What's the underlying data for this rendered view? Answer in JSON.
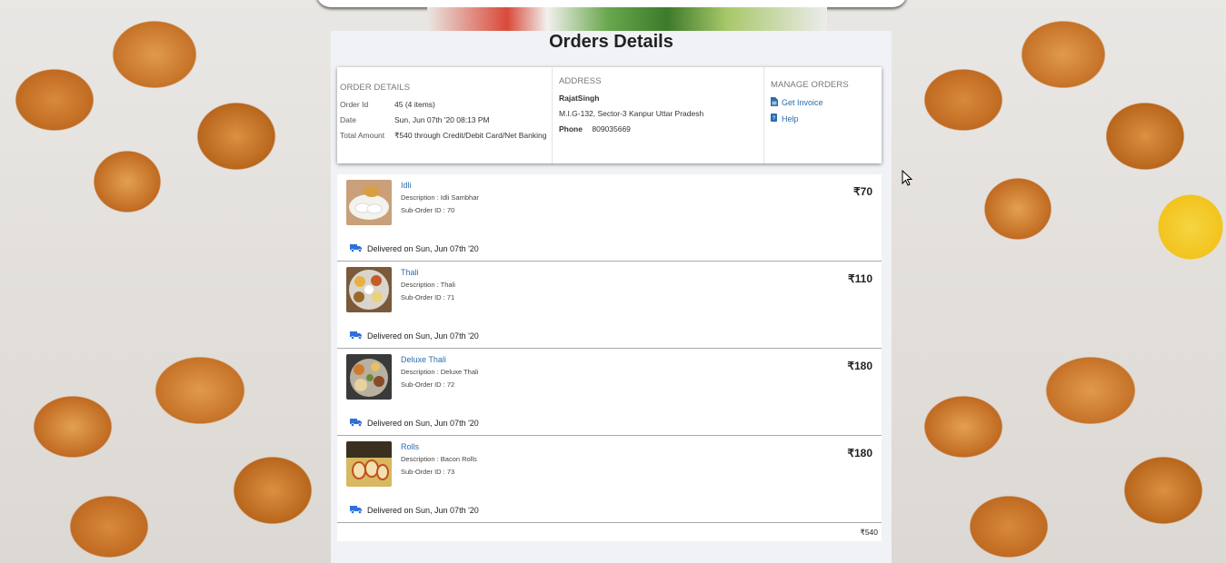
{
  "page": {
    "title": "Orders Details"
  },
  "order_details": {
    "heading": "ORDER DETAILS",
    "rows": [
      {
        "label": "Order Id",
        "value": "45 (4 items)"
      },
      {
        "label": "Date",
        "value": "Sun, Jun 07th '20 08:13 PM"
      },
      {
        "label": "Total Amount",
        "value": "₹540 through Credit/Debit Card/Net Banking"
      }
    ]
  },
  "address": {
    "heading": "ADDRESS",
    "name": "RajatSingh",
    "line": "M.I.G-132, Sector-3 Kanpur Uttar Pradesh",
    "phone_label": "Phone",
    "phone": "809035669"
  },
  "manage": {
    "heading": "MANAGE ORDERS",
    "invoice": "Get Invoice",
    "help": "Help"
  },
  "items": [
    {
      "name": "Idli",
      "description": "Description : Idli Sambhar",
      "sub_order": "Sub-Order ID : 70",
      "price": "₹70",
      "status": "Delivered on Sun, Jun 07th '20"
    },
    {
      "name": "Thali",
      "description": "Description : Thali",
      "sub_order": "Sub-Order ID : 71",
      "price": "₹110",
      "status": "Delivered on Sun, Jun 07th '20"
    },
    {
      "name": "Deluxe Thali",
      "description": "Description : Deluxe Thali",
      "sub_order": "Sub-Order ID : 72",
      "price": "₹180",
      "status": "Delivered on Sun, Jun 07th '20"
    },
    {
      "name": "Rolls",
      "description": "Description : Bacon Rolls",
      "sub_order": "Sub-Order ID : 73",
      "price": "₹180",
      "status": "Delivered on Sun, Jun 07th '20"
    }
  ],
  "total": "₹540",
  "colors": {
    "link": "#2a6db0",
    "truck": "#2f6fde",
    "panel_bg": "#f0f2f5"
  },
  "icons": {
    "invoice": "document-icon",
    "help": "help-book-icon",
    "status": "truck-icon"
  }
}
